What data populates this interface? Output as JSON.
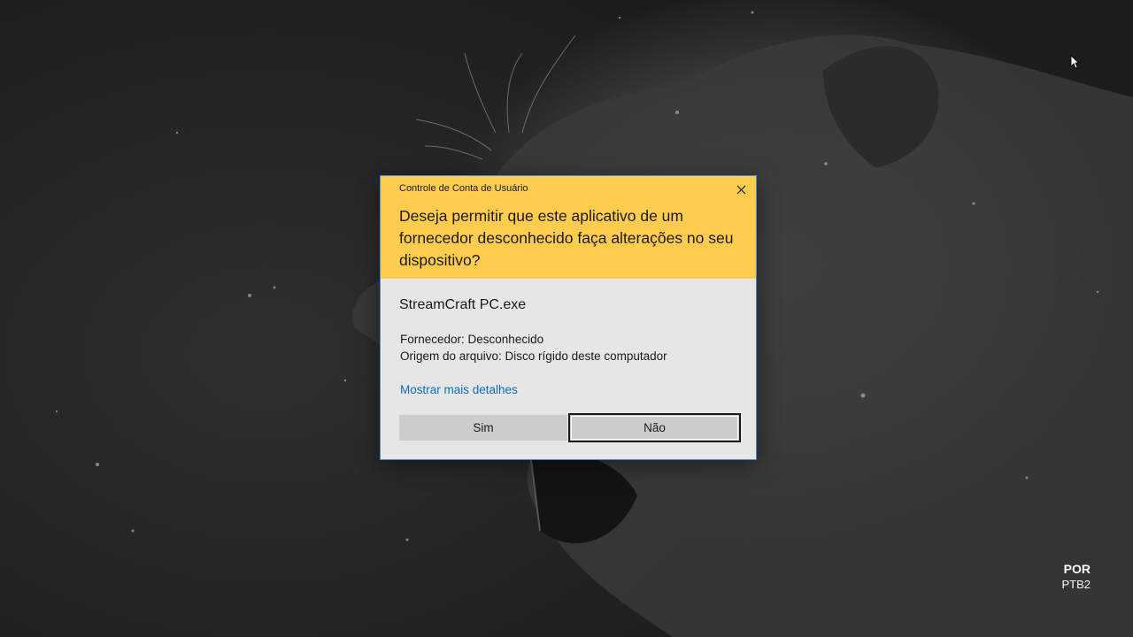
{
  "dialog": {
    "title": "Controle de Conta de Usuário",
    "question": "Deseja permitir que este aplicativo de um fornecedor desconhecido faça alterações no seu dispositivo?",
    "app_name": "StreamCraft PC.exe",
    "publisher": "Fornecedor: Desconhecido",
    "origin": "Origem do arquivo: Disco rígido deste computador",
    "details_link": "Mostrar mais detalhes",
    "yes_label": "Sim",
    "no_label": "Não",
    "header_color": "#ffcc4d",
    "link_color": "#0a6dc2"
  },
  "taskbar": {
    "language": "POR",
    "layout": "PTB2"
  },
  "icons": {
    "close": "close-icon",
    "cursor": "mouse-cursor-icon"
  }
}
